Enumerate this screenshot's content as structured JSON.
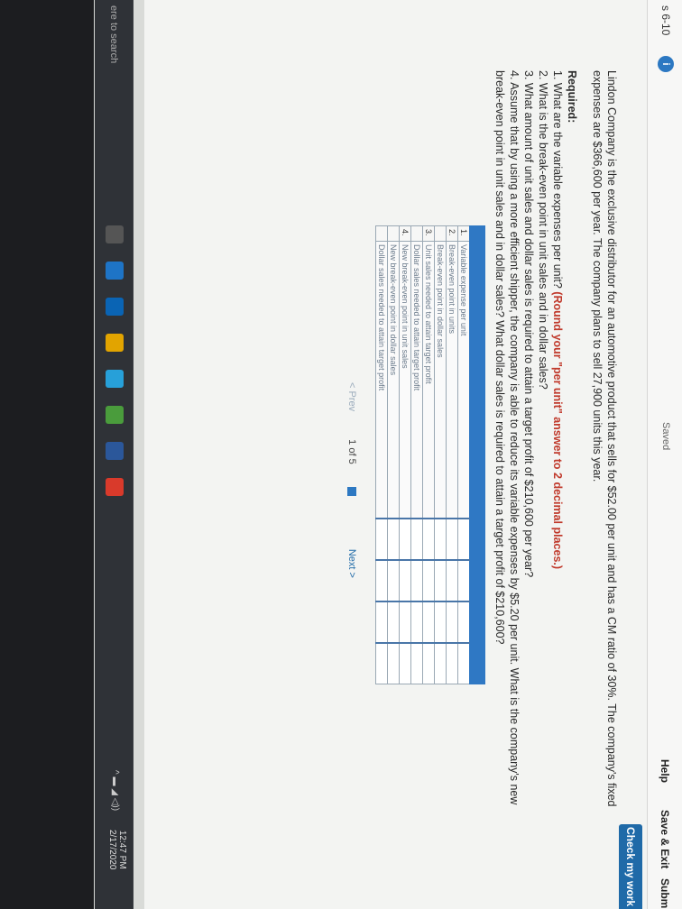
{
  "header": {
    "chapter": "s 6-10",
    "info_icon": "i",
    "saved": "Saved",
    "help": "Help",
    "save_exit": "Save & Exit",
    "submit": "Submi",
    "check_my_work": "Check my work"
  },
  "question": {
    "text": "Lindon Company is the exclusive distributor for an automotive product that sells for $52.00 per unit and has a CM ratio of 30%. The company's fixed expenses are $366,600 per year. The company plans to sell 27,900 units this year.",
    "required_heading": "Required:",
    "items": [
      {
        "pre": "1. What are the variable expenses per unit? ",
        "red": "(Round your \"per unit\" answer to 2 decimal places.)"
      },
      {
        "pre": "2. What is the break-even point in unit sales and in dollar sales?",
        "red": ""
      },
      {
        "pre": "3. What amount of unit sales and dollar sales is required to attain a target profit of $210,600 per year?",
        "red": ""
      },
      {
        "pre": "4. Assume that by using a more efficient shipper, the company is able to reduce its variable expenses by $5.20 per unit. What is the company's new break-even point in unit sales and in dollar sales? What dollar sales is required to attain a target profit of $210,600?",
        "red": ""
      }
    ]
  },
  "table": {
    "rows": [
      {
        "num": "1.",
        "label": "Variable expense per unit"
      },
      {
        "num": "2.",
        "label": "Break-even point in units"
      },
      {
        "num": "",
        "label": "Break-even point in dollar sales"
      },
      {
        "num": "3.",
        "label": "Unit sales needed to attain target profit"
      },
      {
        "num": "",
        "label": "Dollar sales needed to attain target profit"
      },
      {
        "num": "4.",
        "label": "New break-even point in unit sales"
      },
      {
        "num": "",
        "label": "New break-even point in dollar sales"
      },
      {
        "num": "",
        "label": "Dollar sales needed to attain target profit"
      }
    ]
  },
  "pager": {
    "prev": "Prev",
    "position": "1 of 5",
    "next": "Next"
  },
  "taskbar": {
    "search": "ere to search",
    "time": "12:47 PM",
    "date": "2/17/2020"
  }
}
